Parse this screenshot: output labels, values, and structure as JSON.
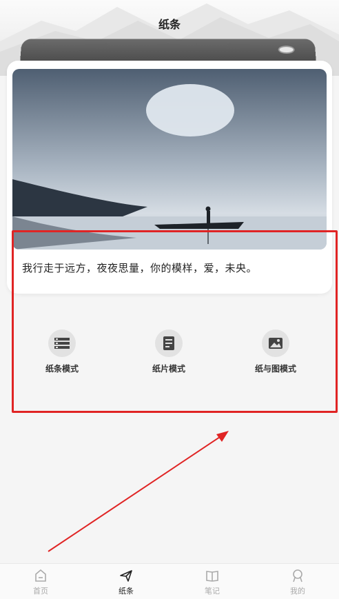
{
  "header": {
    "title": "纸条"
  },
  "card": {
    "text": "我行走于远方，夜夜思量，你的模样，爱，未央。"
  },
  "modes": [
    {
      "label": "纸条模式",
      "icon": "list-icon"
    },
    {
      "label": "纸片模式",
      "icon": "document-icon"
    },
    {
      "label": "纸与图模式",
      "icon": "image-icon"
    }
  ],
  "tabbar": [
    {
      "label": "首页",
      "icon": "home-icon",
      "active": false
    },
    {
      "label": "纸条",
      "icon": "paper-plane-icon",
      "active": true
    },
    {
      "label": "笔记",
      "icon": "book-icon",
      "active": false
    },
    {
      "label": "我的",
      "icon": "profile-icon",
      "active": false
    }
  ],
  "colors": {
    "highlight": "#e02424",
    "active_tab": "#222222",
    "inactive_tab": "#aaaaaa"
  }
}
